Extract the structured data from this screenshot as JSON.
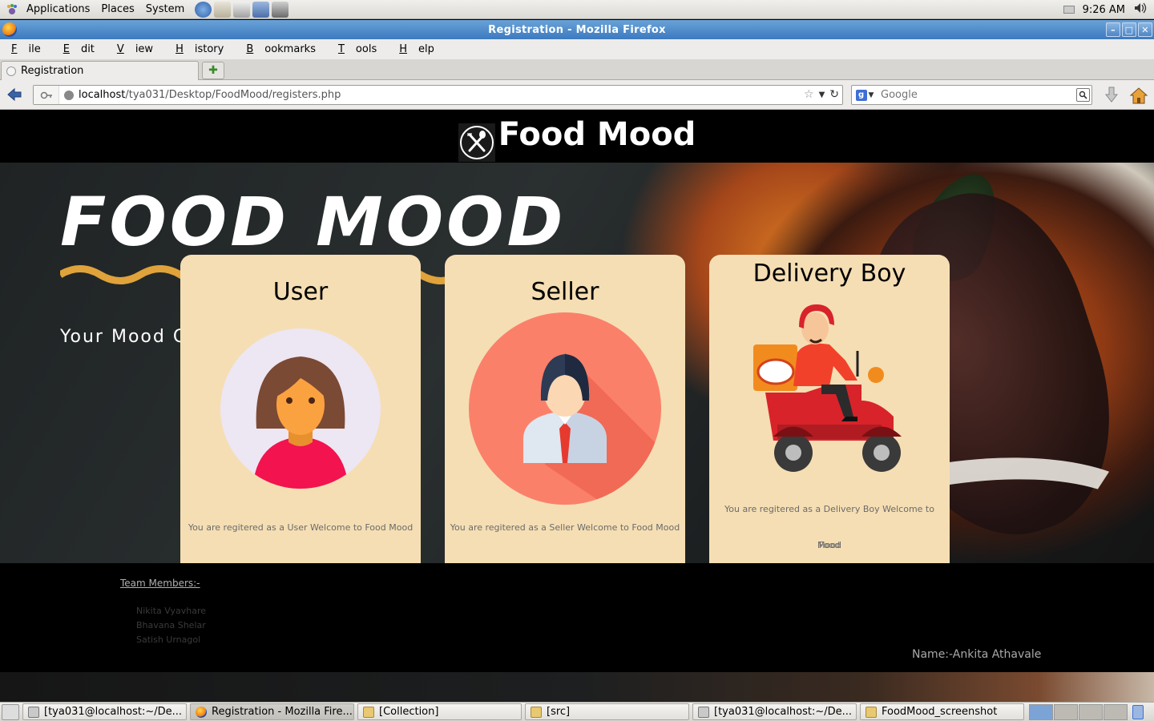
{
  "top_panel": {
    "menus": [
      "Applications",
      "Places",
      "System"
    ],
    "clock": "9:26 AM"
  },
  "window": {
    "title": "Registration - Mozilla Firefox"
  },
  "menubar": {
    "items": [
      {
        "first": "F",
        "rest": "ile"
      },
      {
        "first": "E",
        "rest": "dit"
      },
      {
        "first": "V",
        "rest": "iew"
      },
      {
        "first": "H",
        "rest": "istory"
      },
      {
        "first": "B",
        "rest": "ookmarks"
      },
      {
        "first": "T",
        "rest": "ools"
      },
      {
        "first": "H",
        "rest": "elp"
      }
    ]
  },
  "tabs": [
    {
      "label": "Registration"
    }
  ],
  "navbar": {
    "url_host": "localhost",
    "url_path": "/tya031/Desktop/FoodMood/registers.php",
    "search_placeholder": "Google"
  },
  "site": {
    "title": "Food Mood",
    "hero_title": "FOOD MOOD",
    "hero_subtitle": "Your Mood C"
  },
  "cards": [
    {
      "title": "User",
      "message": "You are regitered as a User Welcome to Food Mood"
    },
    {
      "title": "Seller",
      "message": "You are regitered as a Seller Welcome to Food Mood"
    },
    {
      "title": "Delivery Boy",
      "message_line1": "You are regitered as a Delivery Boy Welcome to Food",
      "message_line2": "Mood"
    }
  ],
  "footer": {
    "team_title": "Team Members:-",
    "members": [
      "Nikita Vyavhare",
      "Bhavana Shelar",
      "Satish Urnagol"
    ],
    "name": "Name:-Ankita Athavale"
  },
  "taskbar": {
    "tasks": [
      {
        "label": "[tya031@localhost:~/De...",
        "icon": "terminal-icon"
      },
      {
        "label": "Registration - Mozilla Fire...",
        "icon": "firefox-icon"
      },
      {
        "label": "[Collection]",
        "icon": "folder-icon"
      },
      {
        "label": "[src]",
        "icon": "folder-icon"
      },
      {
        "label": "[tya031@localhost:~/De...",
        "icon": "terminal-icon"
      },
      {
        "label": "FoodMood_screenshot",
        "icon": "folder-icon"
      }
    ]
  },
  "colors": {
    "card_bg": "#f5deb3",
    "titlebar": "#3c79c0",
    "wave": "#e0a23a"
  }
}
